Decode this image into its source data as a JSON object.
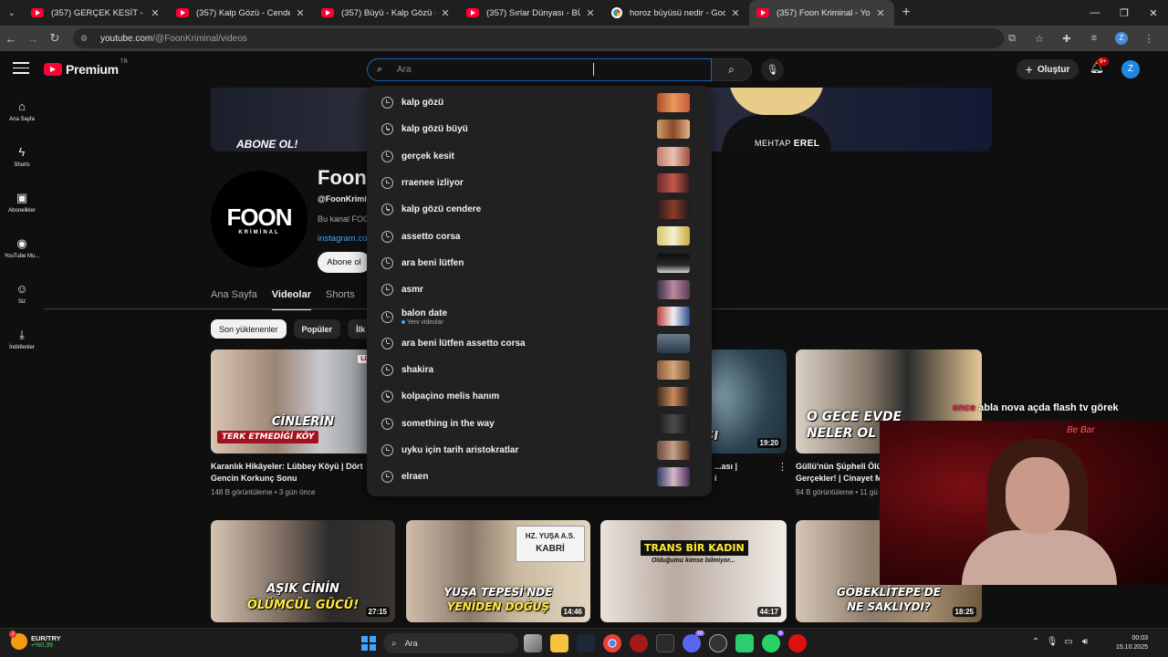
{
  "browser": {
    "tabs": [
      {
        "title": "(357) GERÇEK KESİT - YASAK AŞ",
        "icon": "youtube-icon",
        "active": false
      },
      {
        "title": "(357) Kalp Gözü - Cendere - Yo",
        "icon": "youtube-icon",
        "active": false
      },
      {
        "title": "(357) Büyü - Kalp Gözü - YouTu",
        "icon": "youtube-icon",
        "active": false
      },
      {
        "title": "(357) Sırlar Dünyası - BÜYÜCÜ",
        "icon": "youtube-icon",
        "active": false
      },
      {
        "title": "horoz büyüsü nedir - Google'd",
        "icon": "google-icon",
        "active": false
      },
      {
        "title": "(357) Foon Kriminal - YouTube",
        "icon": "youtube-icon",
        "active": true
      }
    ],
    "url_host": "youtube.com",
    "url_path": "/@FoonKriminal/videos"
  },
  "header": {
    "logo_text": "Premium",
    "logo_region": "TR",
    "search_placeholder": "Ara",
    "search_value": "",
    "create_label": "Oluştur",
    "notification_count": "9+",
    "avatar_letter": "Z"
  },
  "guide": [
    {
      "label": "Ana Sayfa",
      "icon": "home-icon"
    },
    {
      "label": "Shorts",
      "icon": "shorts-icon"
    },
    {
      "label": "Abonelikler",
      "icon": "subscriptions-icon"
    },
    {
      "label": "YouTube Mu...",
      "icon": "youtube-music-icon"
    },
    {
      "label": "Siz",
      "icon": "you-icon"
    },
    {
      "label": "İndirilenler",
      "icon": "downloads-icon"
    }
  ],
  "banner": {
    "left_text": "ABONE OL!",
    "right_first": "MEHTAP",
    "right_last": "EREL"
  },
  "channel": {
    "avatar_big": "FOON",
    "avatar_small": "KRİMİNAL",
    "name": "Foon",
    "handle": "@FoonKrimin",
    "description": "Bu kanal FOO",
    "link": "instagram.co",
    "subscribe_label": "Abone ol",
    "tabs": [
      {
        "label": "Ana Sayfa",
        "active": false
      },
      {
        "label": "Videolar",
        "active": true
      },
      {
        "label": "Shorts",
        "active": false
      },
      {
        "label": "C",
        "active": false
      }
    ],
    "chips": [
      {
        "label": "Son yüklenenler",
        "active": true
      },
      {
        "label": "Popüler",
        "active": false
      },
      {
        "label": "İlk y",
        "active": false
      }
    ]
  },
  "videos": [
    {
      "caption1": "CİNLERİN",
      "caption2": "TERK ETMEDİĞİ KÖY",
      "badge": "LÜBBEY",
      "title1": "Karanlık Hikâyeler: Lübbey Köyü | Dört",
      "title2": "Gencin Korkunç Sonu",
      "meta": "148 B görüntüleme • 3 gün önce"
    },
    {
      "caption1": "",
      "caption2": "",
      "title1": "",
      "title2": "",
      "meta": ""
    },
    {
      "caption1": "SI",
      "duration": "19:20",
      "title1": "...ası |",
      "title2": "i",
      "meta": ""
    },
    {
      "caption1": "O GECE EVDE",
      "caption2": "NELER OL",
      "title1": "Güllü'nün Şüpheli Ölüm",
      "title2": "Gerçekler! | Cinayet M",
      "meta": "94 B görüntüleme • 11 gü"
    },
    {
      "caption1": "AŞIK CİNİN",
      "caption2": "ÖLÜMCÜL GÜCÜ!",
      "duration": "27:15"
    },
    {
      "caption1": "YUŞA TEPESİ'NDE",
      "caption2": "YENİDEN DOĞUŞ",
      "sign1": "HZ. YUŞA A.S.",
      "sign2": "KABRİ",
      "duration": "14:46"
    },
    {
      "caption1": "TRANS BİR KADIN",
      "caption2": "Olduğumu kimse bilmiyor...",
      "duration": "44:17"
    },
    {
      "caption1": "GÖBEKLİTEPE'DE",
      "caption2": "NE SAKLIYDI?",
      "duration": "18:25"
    }
  ],
  "suggestions": [
    {
      "text": "kalp gözü",
      "sub": ""
    },
    {
      "text": "kalp gözü büyü",
      "sub": ""
    },
    {
      "text": "gerçek kesit",
      "sub": ""
    },
    {
      "text": "rraenee izliyor",
      "sub": ""
    },
    {
      "text": "kalp gözü cendere",
      "sub": ""
    },
    {
      "text": "assetto corsa",
      "sub": ""
    },
    {
      "text": "ara beni lütfen",
      "sub": ""
    },
    {
      "text": "asmr",
      "sub": ""
    },
    {
      "text": "balon date",
      "sub": "Yeni videolar"
    },
    {
      "text": "ara beni lütfen assetto corsa",
      "sub": ""
    },
    {
      "text": "shakira",
      "sub": ""
    },
    {
      "text": "kolpaçino melis hanım",
      "sub": ""
    },
    {
      "text": "something in the way",
      "sub": ""
    },
    {
      "text": "uyku için tarih aristokratlar",
      "sub": ""
    },
    {
      "text": "elraen",
      "sub": ""
    }
  ],
  "overlay": {
    "prefix": "ence",
    "text": "abla nova açda flash tv görek",
    "webcam_sign": "Be Bar"
  },
  "taskbar": {
    "currency": "EUR/TRY",
    "change": "+%0,39",
    "weather_badge": "1",
    "search_label": "Ara",
    "discord_badge": "18",
    "whatsapp_badge": "6",
    "time": "00:03",
    "date": "15.10.2025"
  },
  "colors": {
    "accent_red": "#ff0033",
    "link_blue": "#3ea6ff",
    "search_focus": "#1c62b9"
  }
}
